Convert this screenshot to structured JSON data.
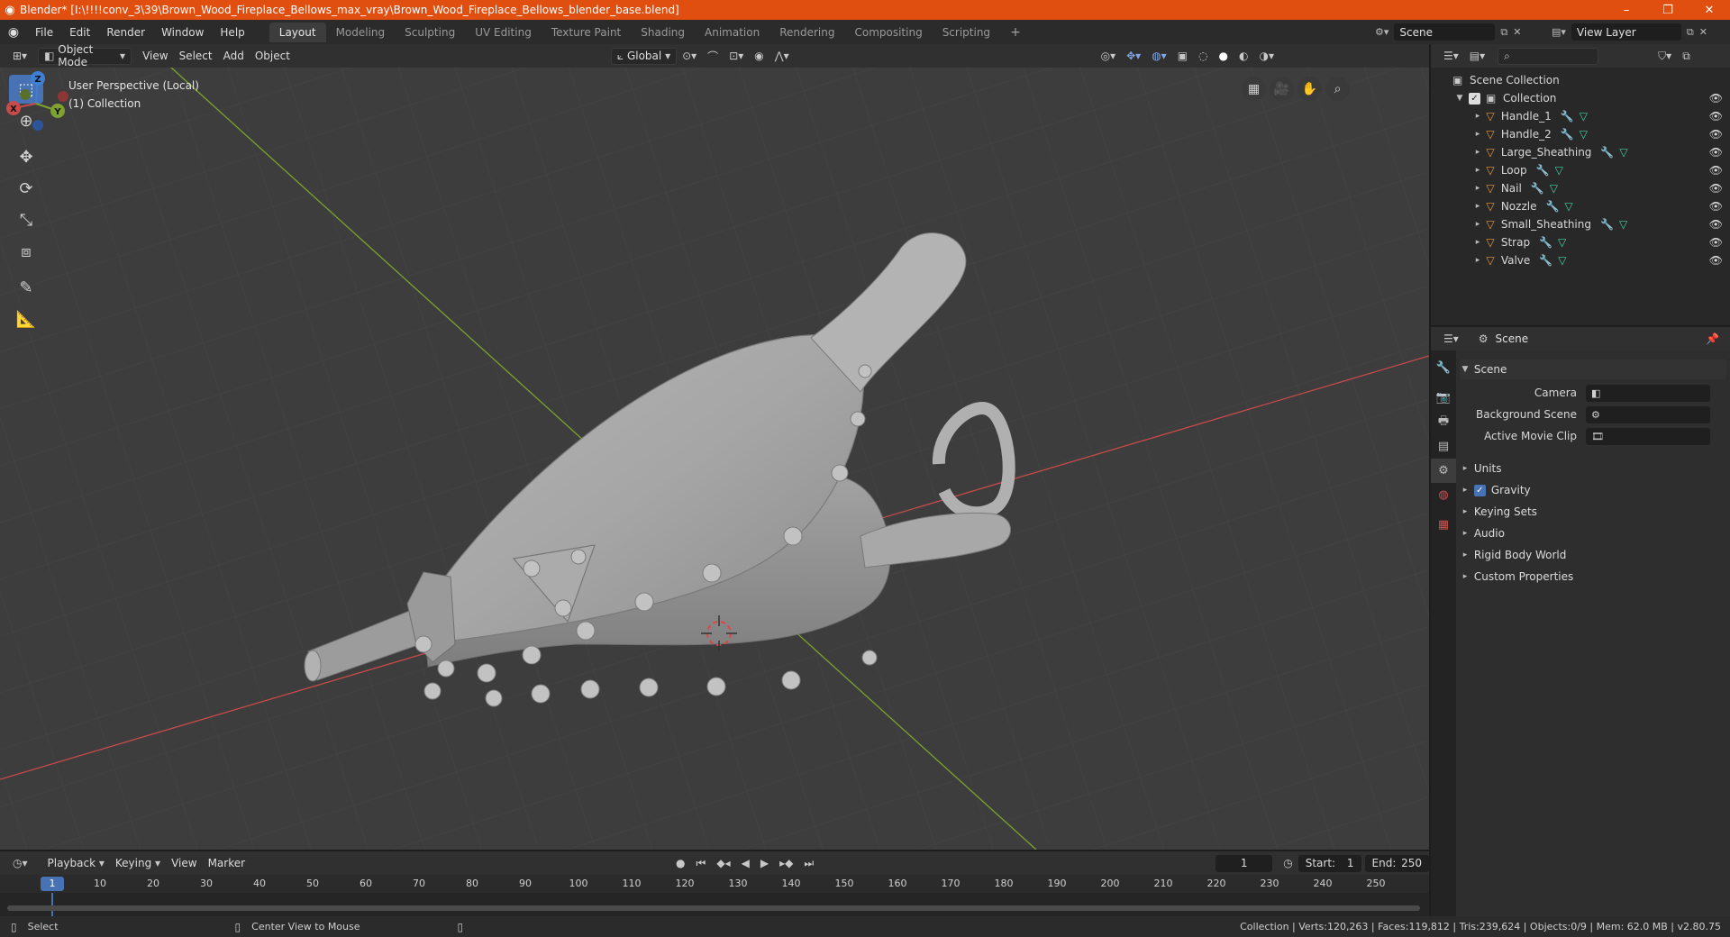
{
  "titlebar": {
    "title": "Blender* [I:\\!!!!conv_3\\39\\Brown_Wood_Fireplace_Bellows_max_vray\\Brown_Wood_Fireplace_Bellows_blender_base.blend]",
    "minimize": "–",
    "maximize": "❐",
    "close": "✕"
  },
  "menubar": {
    "items": [
      "File",
      "Edit",
      "Render",
      "Window",
      "Help"
    ]
  },
  "workspaces": {
    "tabs": [
      "Layout",
      "Modeling",
      "Sculpting",
      "UV Editing",
      "Texture Paint",
      "Shading",
      "Animation",
      "Rendering",
      "Compositing",
      "Scripting"
    ],
    "active": "Layout",
    "add": "+"
  },
  "scene_selector": {
    "value": "Scene"
  },
  "view_layer_selector": {
    "value": "View Layer"
  },
  "viewport_header": {
    "mode": "Object Mode",
    "menus": [
      "View",
      "Select",
      "Add",
      "Object"
    ],
    "transform_orientation": "Global"
  },
  "viewport": {
    "perspective": "User Perspective (Local)",
    "collection": "(1) Collection",
    "gizmo": {
      "z": "Z",
      "y": "Y",
      "x": "X"
    }
  },
  "outliner": {
    "root": "Scene Collection",
    "collection": "Collection",
    "objects": [
      "Handle_1",
      "Handle_2",
      "Large_Sheathing",
      "Loop",
      "Nail",
      "Nozzle",
      "Small_Sheathing",
      "Strap",
      "Valve"
    ]
  },
  "properties": {
    "header": "Scene",
    "section": "Scene",
    "fields": [
      {
        "label": "Camera"
      },
      {
        "label": "Background Scene"
      },
      {
        "label": "Active Movie Clip"
      }
    ],
    "subsections": [
      "Units",
      "Gravity",
      "Keying Sets",
      "Audio",
      "Rigid Body World",
      "Custom Properties"
    ]
  },
  "timeline": {
    "menus": [
      "Playback",
      "Keying",
      "View",
      "Marker"
    ],
    "current_frame": "1",
    "start_label": "Start:",
    "start": "1",
    "end_label": "End:",
    "end": "250",
    "ruler": [
      "10",
      "20",
      "30",
      "40",
      "50",
      "60",
      "70",
      "80",
      "90",
      "100",
      "110",
      "120",
      "130",
      "140",
      "150",
      "160",
      "170",
      "180",
      "190",
      "200",
      "210",
      "220",
      "230",
      "240",
      "250"
    ],
    "playhead": "1"
  },
  "statusbar": {
    "select": "Select",
    "center": "Center View to Mouse",
    "stats": "Collection | Verts:120,263 | Faces:119,812 | Tris:239,624 | Objects:0/9 | Mem: 62.0 MB | v2.80.75"
  },
  "colors": {
    "titlebar": "#e04e10",
    "accent": "#4772b3",
    "x_axis": "#c64b4b",
    "y_axis": "#7ea12f",
    "z_axis": "#3f7fd6"
  }
}
